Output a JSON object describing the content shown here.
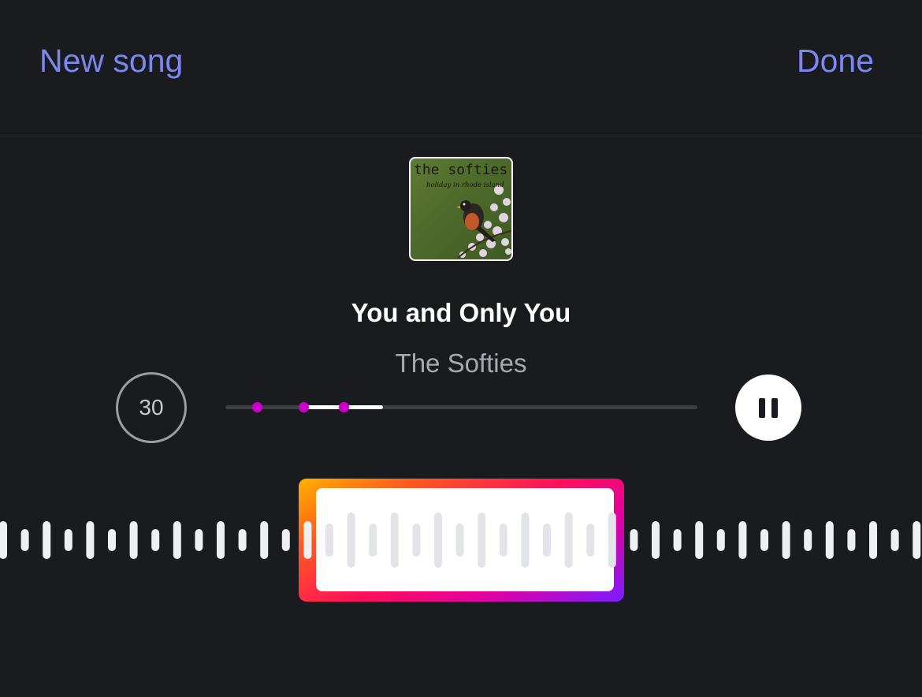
{
  "header": {
    "new_song_label": "New song",
    "done_label": "Done"
  },
  "artwork": {
    "band_name": "the softies",
    "album_title": "holiday in rhode island"
  },
  "song": {
    "title": "You and Only You",
    "artist": "The Softies"
  },
  "controls": {
    "clip_duration": "30",
    "pause_icon": "pause-icon",
    "playback_fraction": 0.167,
    "markers": [
      0.066,
      0.166,
      0.25
    ]
  },
  "colors": {
    "accent": "#7d87f0",
    "background": "#1a1b1f",
    "marker": "#cc00cc",
    "selection_gradient": [
      "#ffb300",
      "#ff0f5b",
      "#e300a0",
      "#7a1cff"
    ]
  }
}
